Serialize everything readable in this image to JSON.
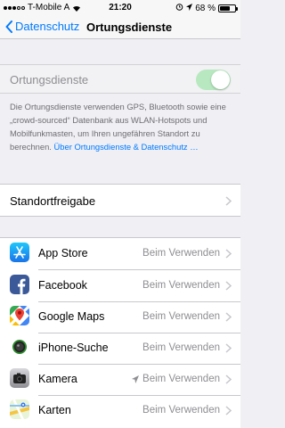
{
  "status_bar": {
    "carrier": "T-Mobile A",
    "time": "21:20",
    "battery": "68 %",
    "signal_bars": 3
  },
  "nav": {
    "back_label": "Datenschutz",
    "title": "Ortungsdienste"
  },
  "location_services": {
    "label": "Ortungsdienste",
    "enabled": true,
    "description": "Die Ortungsdienste verwenden GPS, Bluetooth sowie eine „crowd-sourced“ Datenbank aus WLAN-Hotspots und Mobilfunkmasten, um Ihren ungefähren Standort zu berechnen. ",
    "description_link": "Über Ortungsdienste & Datenschutz …"
  },
  "share_location": {
    "label": "Standortfreigabe"
  },
  "apps": [
    {
      "name": "App Store",
      "value": "Beim Verwenden",
      "icon": "app-store-icon",
      "recent_use": false
    },
    {
      "name": "Facebook",
      "value": "Beim Verwenden",
      "icon": "facebook-icon",
      "recent_use": false
    },
    {
      "name": "Google Maps",
      "value": "Beim Verwenden",
      "icon": "google-maps-icon",
      "recent_use": false
    },
    {
      "name": "iPhone-Suche",
      "value": "Beim Verwenden",
      "icon": "find-iphone-icon",
      "recent_use": false
    },
    {
      "name": "Kamera",
      "value": "Beim Verwenden",
      "icon": "camera-icon",
      "recent_use": true
    },
    {
      "name": "Karten",
      "value": "Beim Verwenden",
      "icon": "maps-icon",
      "recent_use": false
    }
  ],
  "colors": {
    "accent": "#007aff",
    "toggle_on_disabled": "#b7e8bf",
    "secondary_text": "#8e8e93"
  }
}
